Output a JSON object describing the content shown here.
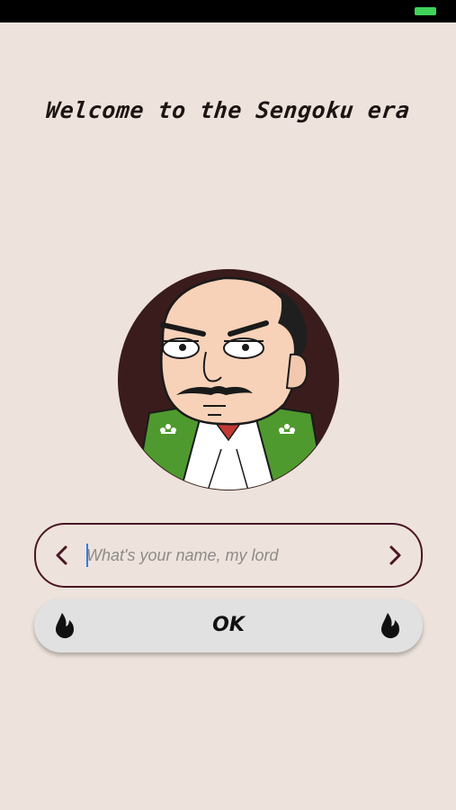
{
  "status_bar": {
    "battery_color": "#3fd35a"
  },
  "welcome": {
    "title": "Welcome to the Sengoku era"
  },
  "portrait": {
    "icon": "samurai-lord-portrait"
  },
  "name_field": {
    "value": "",
    "placeholder": "What's your name, my lord",
    "prev_icon": "chevron-left-icon",
    "next_icon": "chevron-right-icon",
    "border_color": "#4a1624"
  },
  "ok_button": {
    "label": "OK",
    "icon": "flame-icon"
  },
  "colors": {
    "background": "#ede3dc",
    "accent": "#4a1624",
    "kimono_green": "#4f9a2e"
  }
}
